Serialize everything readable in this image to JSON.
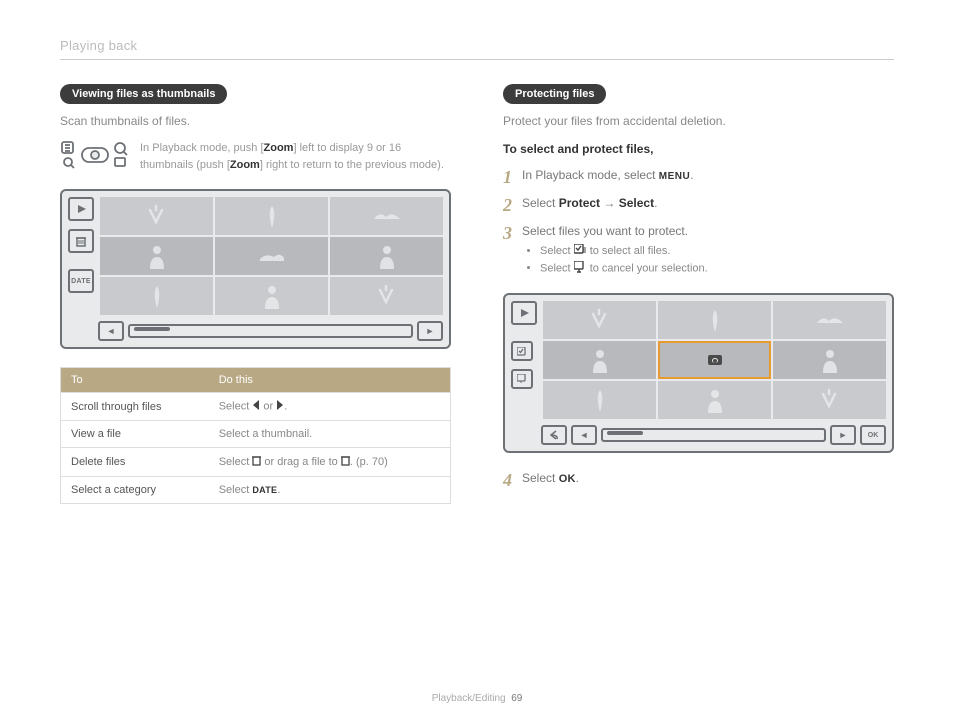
{
  "breadcrumb": "Playing back",
  "left": {
    "pill": "Viewing files as thumbnails",
    "lead": "Scan thumbnails of files.",
    "zoom_pre": "In Playback mode, push [",
    "zoom_b1": "Zoom",
    "zoom_mid": "] left to display 9 or 16 thumbnails (push [",
    "zoom_b2": "Zoom",
    "zoom_post": "] right to return to the previous mode).",
    "date_btn": "DATE",
    "table": {
      "head1": "To",
      "head2": "Do this",
      "rows": [
        {
          "a": "Scroll through files",
          "b_pre": "Select ",
          "b_post": " or ",
          "b_end": "."
        },
        {
          "a": "View a file",
          "b": "Select a thumbnail."
        },
        {
          "a": "Delete files",
          "b_pre": "Select ",
          "b_mid": " or drag a file to ",
          "b_end": ". (p. 70)"
        },
        {
          "a": "Select a category",
          "b_pre": "Select ",
          "b_end": "."
        }
      ]
    }
  },
  "right": {
    "pill": "Protecting files",
    "lead": "Protect your files from accidental deletion.",
    "sub": "To select and protect files,",
    "step1_pre": "In Playback mode, select ",
    "step1_post": ".",
    "step2_pre": "Select ",
    "step2_b1": "Protect",
    "step2_arrow": " → ",
    "step2_b2": "Select",
    "step2_post": ".",
    "step3": "Select files you want to protect.",
    "step3a_pre": "Select ",
    "step3a_post": " to select all files.",
    "step3b_pre": "Select ",
    "step3b_post": " to cancel your selection.",
    "step4_pre": "Select ",
    "step4_post": ".",
    "ok_btn": "OK"
  },
  "footer": {
    "section": "Playback/Editing",
    "page": "69"
  },
  "glyph": {
    "menu": "MENU",
    "ok": "OK",
    "date": "DATE"
  }
}
